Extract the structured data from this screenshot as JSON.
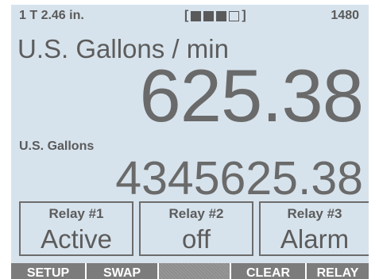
{
  "status": {
    "left": "1 T 2.46 in.",
    "bracket_open": "[",
    "bracket_close": "]",
    "signal_blocks": [
      "filled",
      "filled",
      "filled",
      "empty"
    ],
    "signal_level": 0.75,
    "right": "1480"
  },
  "rate": {
    "unit": "U.S. Gallons / min",
    "value": "625.38"
  },
  "total": {
    "unit": "U.S. Gallons",
    "value": "4345625.38"
  },
  "relays": [
    {
      "label": "Relay #1",
      "state": "Active"
    },
    {
      "label": "Relay #2",
      "state": "off"
    },
    {
      "label": "Relay #3",
      "state": "Alarm"
    }
  ],
  "softkeys": [
    "SETUP",
    "SWAP",
    "",
    "CLEAR",
    "RELAY"
  ],
  "colors": {
    "screen_background": "#d7e3ec",
    "text": "#5c5c5c",
    "softkey_background": "#7c7c7c",
    "softkey_text": "#ffffff"
  }
}
